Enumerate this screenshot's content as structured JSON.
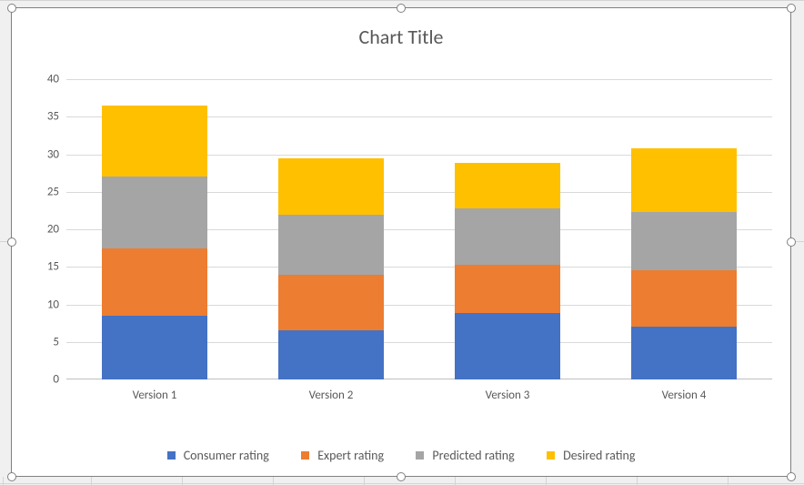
{
  "chart_data": {
    "type": "bar",
    "stacked": true,
    "title": "Chart Title",
    "categories": [
      "Version 1",
      "Version 2",
      "Version 3",
      "Version 4"
    ],
    "series": [
      {
        "name": "Consumer rating",
        "color": "#4472C4",
        "values": [
          8.5,
          6.5,
          8.8,
          7.0
        ]
      },
      {
        "name": "Expert rating",
        "color": "#ED7D31",
        "values": [
          9.0,
          7.5,
          6.5,
          7.5
        ]
      },
      {
        "name": "Predicted rating",
        "color": "#A5A5A5",
        "values": [
          9.5,
          8.0,
          7.5,
          7.8
        ]
      },
      {
        "name": "Desired rating",
        "color": "#FFC000",
        "values": [
          9.5,
          7.5,
          6.0,
          8.5
        ]
      }
    ],
    "xlabel": "",
    "ylabel": "",
    "ylim": [
      0,
      40
    ],
    "yticks": [
      0,
      5,
      10,
      15,
      20,
      25,
      30,
      35,
      40
    ],
    "grid": true,
    "legend_position": "bottom"
  }
}
